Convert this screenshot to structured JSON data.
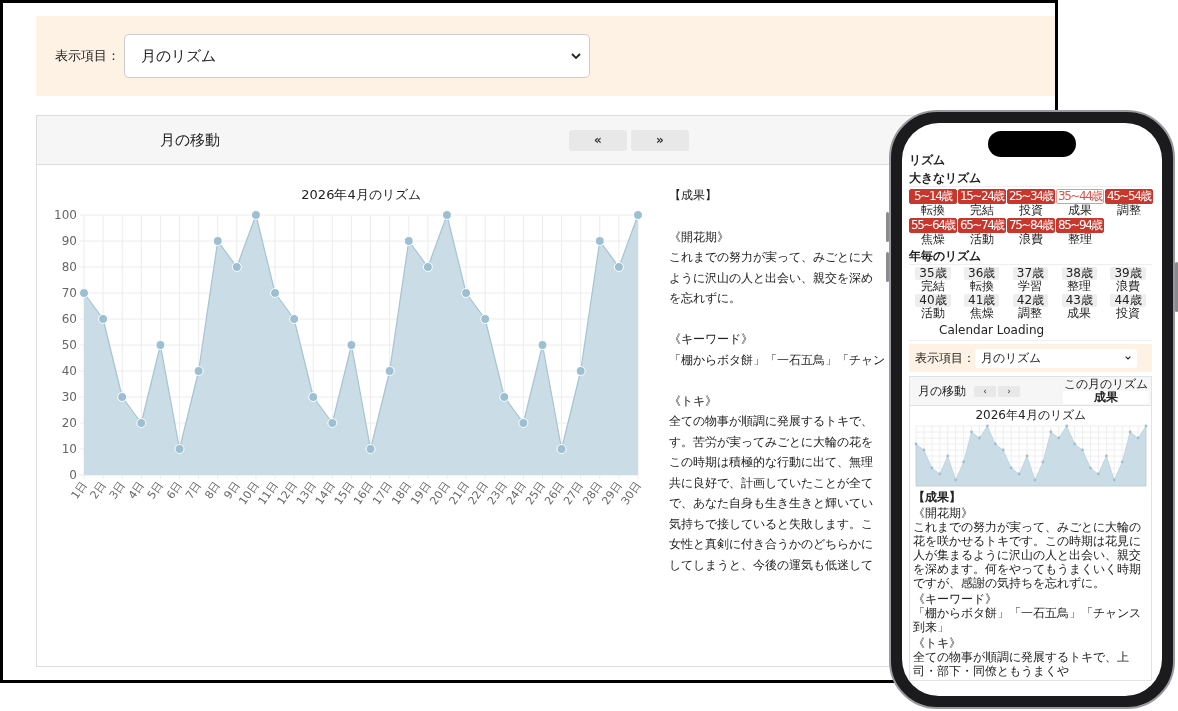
{
  "desktop": {
    "filter": {
      "label": "表示項目：",
      "value": "月のリズム"
    },
    "card": {
      "title": "月の移動",
      "nav_buttons": [
        "«",
        "»"
      ],
      "chart_data": {
        "type": "area",
        "title": "2026年4月のリズム",
        "categories": [
          "1日",
          "2日",
          "3日",
          "4日",
          "5日",
          "6日",
          "7日",
          "8日",
          "9日",
          "10日",
          "11日",
          "12日",
          "13日",
          "14日",
          "15日",
          "16日",
          "17日",
          "18日",
          "19日",
          "20日",
          "21日",
          "22日",
          "23日",
          "24日",
          "25日",
          "26日",
          "27日",
          "28日",
          "29日",
          "30日"
        ],
        "values": [
          70,
          60,
          30,
          20,
          50,
          10,
          40,
          90,
          80,
          100,
          70,
          60,
          30,
          20,
          50,
          10,
          40,
          90,
          80,
          100,
          70,
          60,
          30,
          20,
          50,
          10,
          40,
          90,
          80,
          100
        ],
        "ylim": [
          0,
          100
        ],
        "yticks": [
          0,
          10,
          20,
          30,
          40,
          50,
          60,
          70,
          80,
          90,
          100
        ],
        "grid": true
      },
      "result": {
        "heading": "【成果】",
        "sections": [
          {
            "title": "《開花期》",
            "lines": [
              "これまでの努力が実って、みごとに大",
              "ように沢山の人と出会い、親交を深め",
              "を忘れずに。"
            ]
          },
          {
            "title": "《キーワード》",
            "lines": [
              "「棚からボタ餅」「一石五鳥」「チャン"
            ]
          },
          {
            "title": "《トキ》",
            "lines": [
              "全ての物事が順調に発展するトキで、",
              "す。苦労が実ってみごとに大輪の花を",
              "この時期は積極的な行動に出て、無理",
              "共に良好で、計画していたことが全て",
              "で、あなた自身も生き生きと輝いてい",
              "気持ちで接していると失敗します。こ",
              "女性と真剣に付き合うかのどちらかに",
              "してしまうと、今後の運気も低迷して"
            ]
          }
        ]
      }
    }
  },
  "phone": {
    "title": "リズム",
    "big_rhythm": {
      "heading": "大きなリズム",
      "items": [
        {
          "age": "5~14歳",
          "label": "転換",
          "selected": false
        },
        {
          "age": "15~24歳",
          "label": "完結",
          "selected": false
        },
        {
          "age": "25~34歳",
          "label": "投資",
          "selected": false
        },
        {
          "age": "35~44歳",
          "label": "成果",
          "selected": true
        },
        {
          "age": "45~54歳",
          "label": "調整",
          "selected": false
        },
        {
          "age": "55~64歳",
          "label": "焦燥",
          "selected": false
        },
        {
          "age": "65~74歳",
          "label": "活動",
          "selected": false
        },
        {
          "age": "75~84歳",
          "label": "浪費",
          "selected": false
        },
        {
          "age": "85~94歳",
          "label": "整理",
          "selected": false
        }
      ]
    },
    "yearly_rhythm": {
      "heading": "年毎のリズム",
      "items": [
        {
          "age": "35歳",
          "label": "完結"
        },
        {
          "age": "36歳",
          "label": "転換"
        },
        {
          "age": "37歳",
          "label": "学習"
        },
        {
          "age": "38歳",
          "label": "整理"
        },
        {
          "age": "39歳",
          "label": "浪費"
        },
        {
          "age": "40歳",
          "label": "活動"
        },
        {
          "age": "41歳",
          "label": "焦燥"
        },
        {
          "age": "42歳",
          "label": "調整"
        },
        {
          "age": "43歳",
          "label": "成果"
        },
        {
          "age": "44歳",
          "label": "投資"
        }
      ]
    },
    "loading": "Calendar Loading",
    "filter": {
      "label": "表示項目：",
      "value": "月のリズム"
    },
    "card": {
      "title": "月の移動",
      "nav_buttons": [
        "‹",
        "›"
      ],
      "month_rhythm_label": "この月のリズム",
      "month_rhythm": "成果",
      "chart_title": "2026年4月のリズム",
      "result": {
        "heading": "【成果】",
        "sections": [
          {
            "title": "《開花期》",
            "lines": [
              "これまでの努力が実って、みごとに大輪の花を咲かせるトキです。この時期は花見に人が集まるように沢山の人と出会い、親交を深めます。何をやってもうまくいく時期ですが、感謝の気持ちを忘れずに。"
            ]
          },
          {
            "title": "《キーワード》",
            "lines": [
              "「棚からボタ餅」「一石五鳥」「チャンス到来」"
            ]
          },
          {
            "title": "《トキ》",
            "lines": [
              "全ての物事が順調に発展するトキで、上司・部下・同僚ともうまくや"
            ]
          }
        ]
      }
    }
  }
}
